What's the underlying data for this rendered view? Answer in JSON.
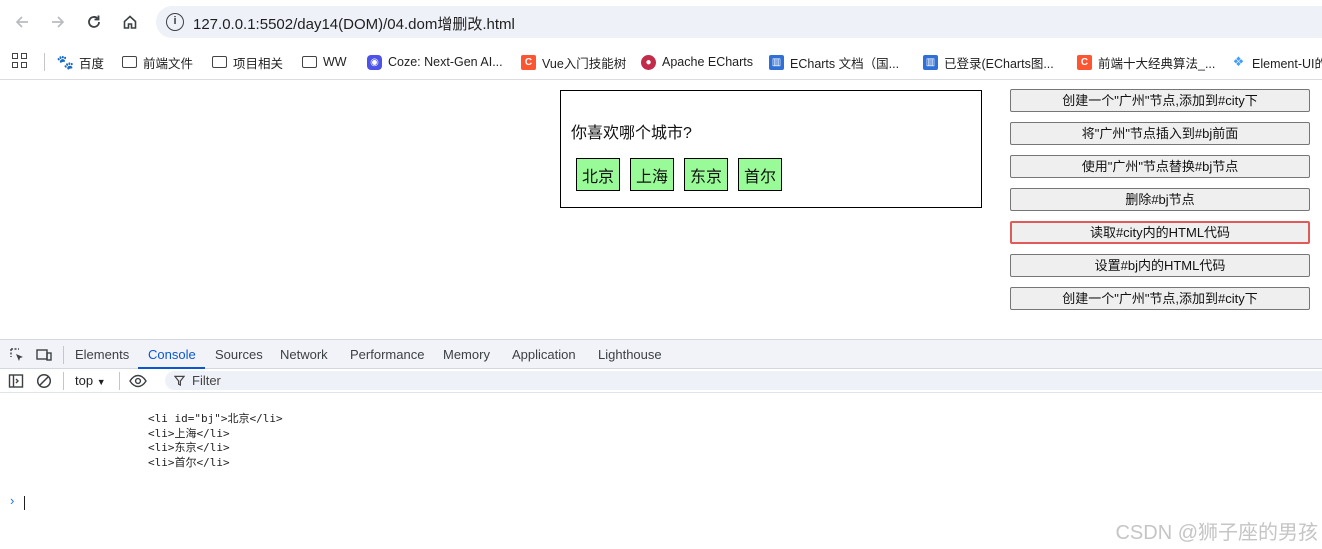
{
  "browser": {
    "back_icon": "arrow-left-icon",
    "forward_icon": "arrow-right-icon",
    "reload_icon": "reload-icon",
    "home_icon": "home-icon",
    "url": "127.0.0.1:5502/day14(DOM)/04.dom增删改.html",
    "bookmarks": [
      {
        "label": "百度",
        "icon": "baidu-icon"
      },
      {
        "label": "前端文件",
        "icon": "folder-icon"
      },
      {
        "label": "项目相关",
        "icon": "folder-icon"
      },
      {
        "label": "WW",
        "icon": "folder-icon"
      },
      {
        "label": "Coze: Next-Gen AI...",
        "icon": "coze-icon"
      },
      {
        "label": "Vue入门技能树",
        "icon": "csdn-icon"
      },
      {
        "label": "Apache ECharts",
        "icon": "apache-icon"
      },
      {
        "label": "ECharts 文档（国...",
        "icon": "echarts-icon"
      },
      {
        "label": "已登录(ECharts图...",
        "icon": "echarts-icon"
      },
      {
        "label": "前端十大经典算法_...",
        "icon": "csdn-icon"
      },
      {
        "label": "Element-UI的",
        "icon": "element-icon"
      }
    ]
  },
  "page": {
    "question": "你喜欢哪个城市?",
    "cities": [
      "北京",
      "上海",
      "东京",
      "首尔"
    ],
    "city_color": "#98fb98",
    "buttons": [
      "创建一个\"广州\"节点,添加到#city下",
      "将\"广州\"节点插入到#bj前面",
      "使用\"广州\"节点替换#bj节点",
      "删除#bj节点",
      "读取#city内的HTML代码",
      "设置#bj内的HTML代码",
      "创建一个\"广州\"节点,添加到#city下"
    ],
    "focused_button_index": 4
  },
  "devtools": {
    "tabs": [
      "Elements",
      "Console",
      "Sources",
      "Network",
      "Performance",
      "Memory",
      "Application",
      "Lighthouse"
    ],
    "active_tab": "Console",
    "context": "top",
    "filter_placeholder": "Filter",
    "output_lines": [
      "<li id=\"bj\">北京</li>",
      "<li>上海</li>",
      "<li>东京</li>",
      "<li>首尔</li>"
    ],
    "prompt_symbol": "›"
  },
  "watermark": "CSDN @狮子座的男孩"
}
